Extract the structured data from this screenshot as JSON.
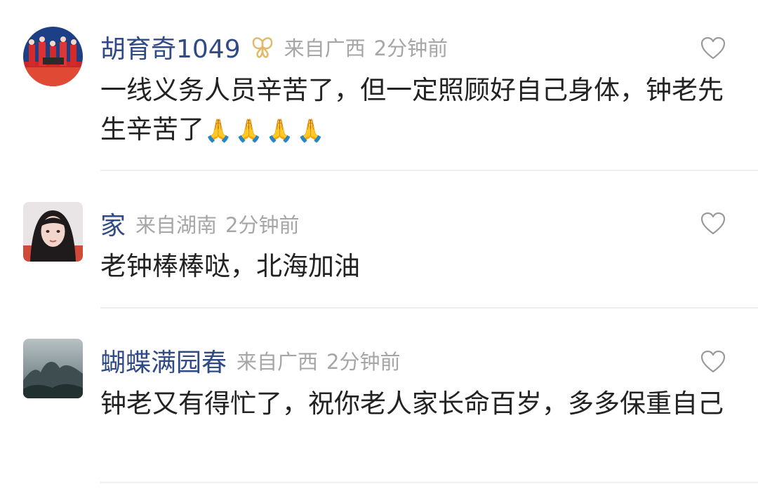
{
  "comments": [
    {
      "name": "胡育奇1049",
      "location": "来自广西",
      "time": "2分钟前",
      "text": "一线义务人员辛苦了，但一定照顾好自己身体，钟老先生辛苦了",
      "emoji": "🙏🙏🙏🙏",
      "badge_icon": "butterfly-badge-icon"
    },
    {
      "name": "家",
      "location": "来自湖南",
      "time": "2分钟前",
      "text": "老钟棒棒哒，北海加油"
    },
    {
      "name": "蝴蝶满园春",
      "location": "来自广西",
      "time": "2分钟前",
      "text": "钟老又有得忙了，祝你老人家长命百岁，多多保重自己"
    }
  ],
  "icons": {
    "like": "heart-outline-icon"
  },
  "colors": {
    "name": "#2f4a85",
    "meta": "#a6a6a6",
    "text": "#222222",
    "divider": "#eeeeee",
    "badge": "#e2b86a"
  }
}
